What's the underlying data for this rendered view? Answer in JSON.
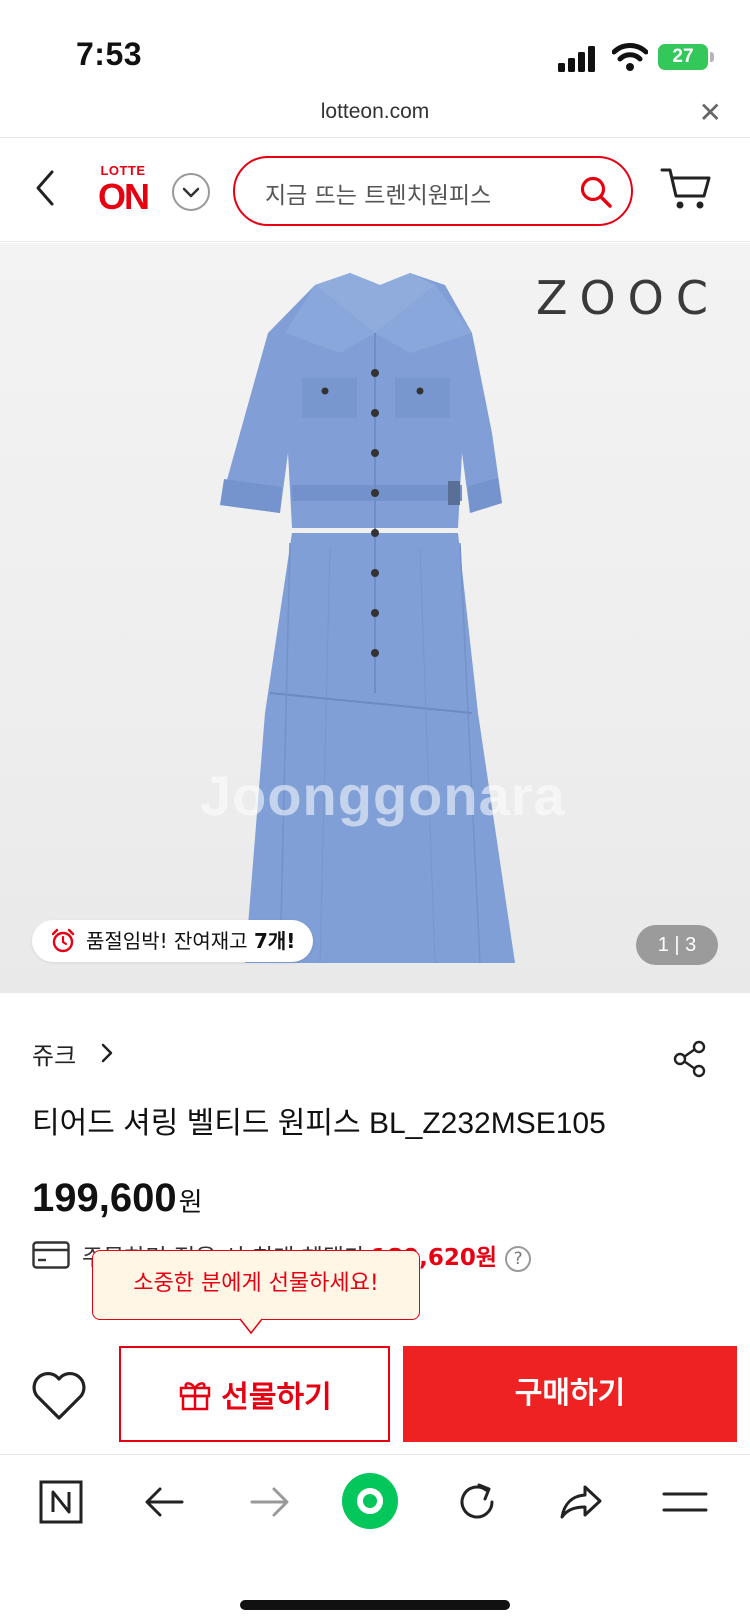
{
  "status_bar": {
    "time": "7:53",
    "battery": "27"
  },
  "url_bar": {
    "domain": "lotteon.com"
  },
  "header": {
    "logo_top": "LOTTE",
    "logo_main": "ON",
    "search_placeholder": "지금 뜨는 트렌치원피스"
  },
  "product_image": {
    "brand_mark": "ZOOC",
    "watermark": "Joonggonara",
    "stock_badge": {
      "prefix": "품절임박! 잔여재고 ",
      "count": "7개!"
    },
    "page_indicator": "1 | 3"
  },
  "product": {
    "brand": "쥬크",
    "title": "티어드 셔링 벨티드 원피스 BL_Z232MSE105",
    "price": "199,600",
    "price_unit": "원",
    "benefit_label": "주문하면 적용 시 최대 혜택가",
    "benefit_price": "189,620원",
    "help": "?"
  },
  "tooltip": {
    "text": "소중한 분에게 선물하세요!"
  },
  "actions": {
    "gift_label": "선물하기",
    "buy_label": "구매하기"
  },
  "colors": {
    "brand_red": "#e60012",
    "buy_red": "#ee2222",
    "dress_blue": "#7f9fd6",
    "battery_green": "#34c759",
    "naver_green": "#03c75a"
  },
  "toolbar_icons": [
    "naver-n-icon",
    "back-arrow-icon",
    "forward-arrow-icon",
    "green-dot-icon",
    "refresh-icon",
    "share-arrow-icon",
    "menu-icon"
  ]
}
